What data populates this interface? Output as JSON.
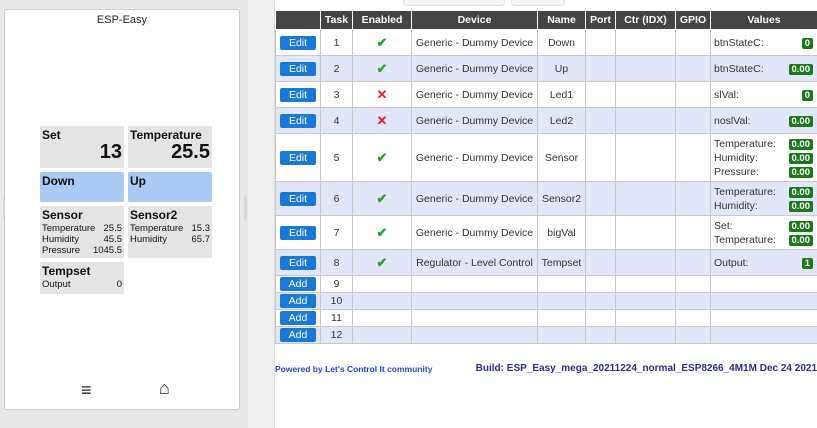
{
  "phone": {
    "title": "ESP-Easy",
    "tiles": {
      "set": {
        "name": "Set",
        "value": "13"
      },
      "temperature": {
        "name": "Temperature",
        "value": "25.5"
      },
      "down": {
        "name": "Down"
      },
      "up": {
        "name": "Up"
      },
      "sensor": {
        "name": "Sensor",
        "rows": [
          {
            "k": "Temperature",
            "v": "25.5"
          },
          {
            "k": "Humidity",
            "v": "45.5"
          },
          {
            "k": "Pressure",
            "v": "1045.5"
          }
        ]
      },
      "sensor2": {
        "name": "Sensor2",
        "rows": [
          {
            "k": "Temperature",
            "v": "15.3"
          },
          {
            "k": "Humidity",
            "v": "65.7"
          }
        ]
      },
      "tempset": {
        "name": "Tempset",
        "rows": [
          {
            "k": "Output",
            "v": "0"
          }
        ]
      }
    },
    "nav": {
      "menu_icon": "≡",
      "home_icon": "⌂"
    }
  },
  "table": {
    "headers": [
      "",
      "Task",
      "Enabled",
      "Device",
      "Name",
      "Port",
      "Ctr (IDX)",
      "GPIO",
      "Values"
    ],
    "edit_label": "Edit",
    "add_label": "Add",
    "rows": [
      {
        "task": "1",
        "enabled": true,
        "device": "Generic - Dummy Device",
        "name": "Down",
        "values": [
          {
            "label": "btnStateC:",
            "value": "0"
          }
        ]
      },
      {
        "task": "2",
        "enabled": true,
        "device": "Generic - Dummy Device",
        "name": "Up",
        "values": [
          {
            "label": "btnStateC:",
            "value": "0.00"
          }
        ]
      },
      {
        "task": "3",
        "enabled": false,
        "device": "Generic - Dummy Device",
        "name": "Led1",
        "values": [
          {
            "label": "slVal:",
            "value": "0"
          }
        ]
      },
      {
        "task": "4",
        "enabled": false,
        "device": "Generic - Dummy Device",
        "name": "Led2",
        "values": [
          {
            "label": "noslVal:",
            "value": "0.00"
          }
        ]
      },
      {
        "task": "5",
        "enabled": true,
        "device": "Generic - Dummy Device",
        "name": "Sensor",
        "values": [
          {
            "label": "Temperature:",
            "value": "0.00"
          },
          {
            "label": "Humidity:",
            "value": "0.00"
          },
          {
            "label": "Pressure:",
            "value": "0.00"
          }
        ]
      },
      {
        "task": "6",
        "enabled": true,
        "device": "Generic - Dummy Device",
        "name": "Sensor2",
        "values": [
          {
            "label": "Temperature:",
            "value": "0.00"
          },
          {
            "label": "Humidity:",
            "value": "0.00"
          }
        ]
      },
      {
        "task": "7",
        "enabled": true,
        "device": "Generic - Dummy Device",
        "name": "bigVal",
        "values": [
          {
            "label": "Set:",
            "value": "0.00"
          },
          {
            "label": "Temperature:",
            "value": "0.00"
          }
        ]
      },
      {
        "task": "8",
        "enabled": true,
        "device": "Regulator - Level Control",
        "name": "Tempset",
        "values": [
          {
            "label": "Output:",
            "value": "1"
          }
        ]
      },
      {
        "task": "9",
        "empty": true
      },
      {
        "task": "10",
        "empty": true
      },
      {
        "task": "11",
        "empty": true
      },
      {
        "task": "12",
        "empty": true
      }
    ],
    "enabled_mark": "✔",
    "disabled_mark": "✕"
  },
  "footer": {
    "powered_prefix": "Powered by ",
    "powered_link": "Let's Control It",
    "powered_suffix": " community",
    "build": "Build: ESP_Easy_mega_20211224_normal_ESP8266_4M1M Dec 24 2021"
  },
  "colors": {
    "edit_button": "#1a78d6",
    "value_badge": "#1a7a1a",
    "enabled": "#28a12a",
    "disabled": "#e0202a",
    "row_alt": "#e2e6fb",
    "header": "#444444",
    "tile_button": "#a9cbf3"
  }
}
